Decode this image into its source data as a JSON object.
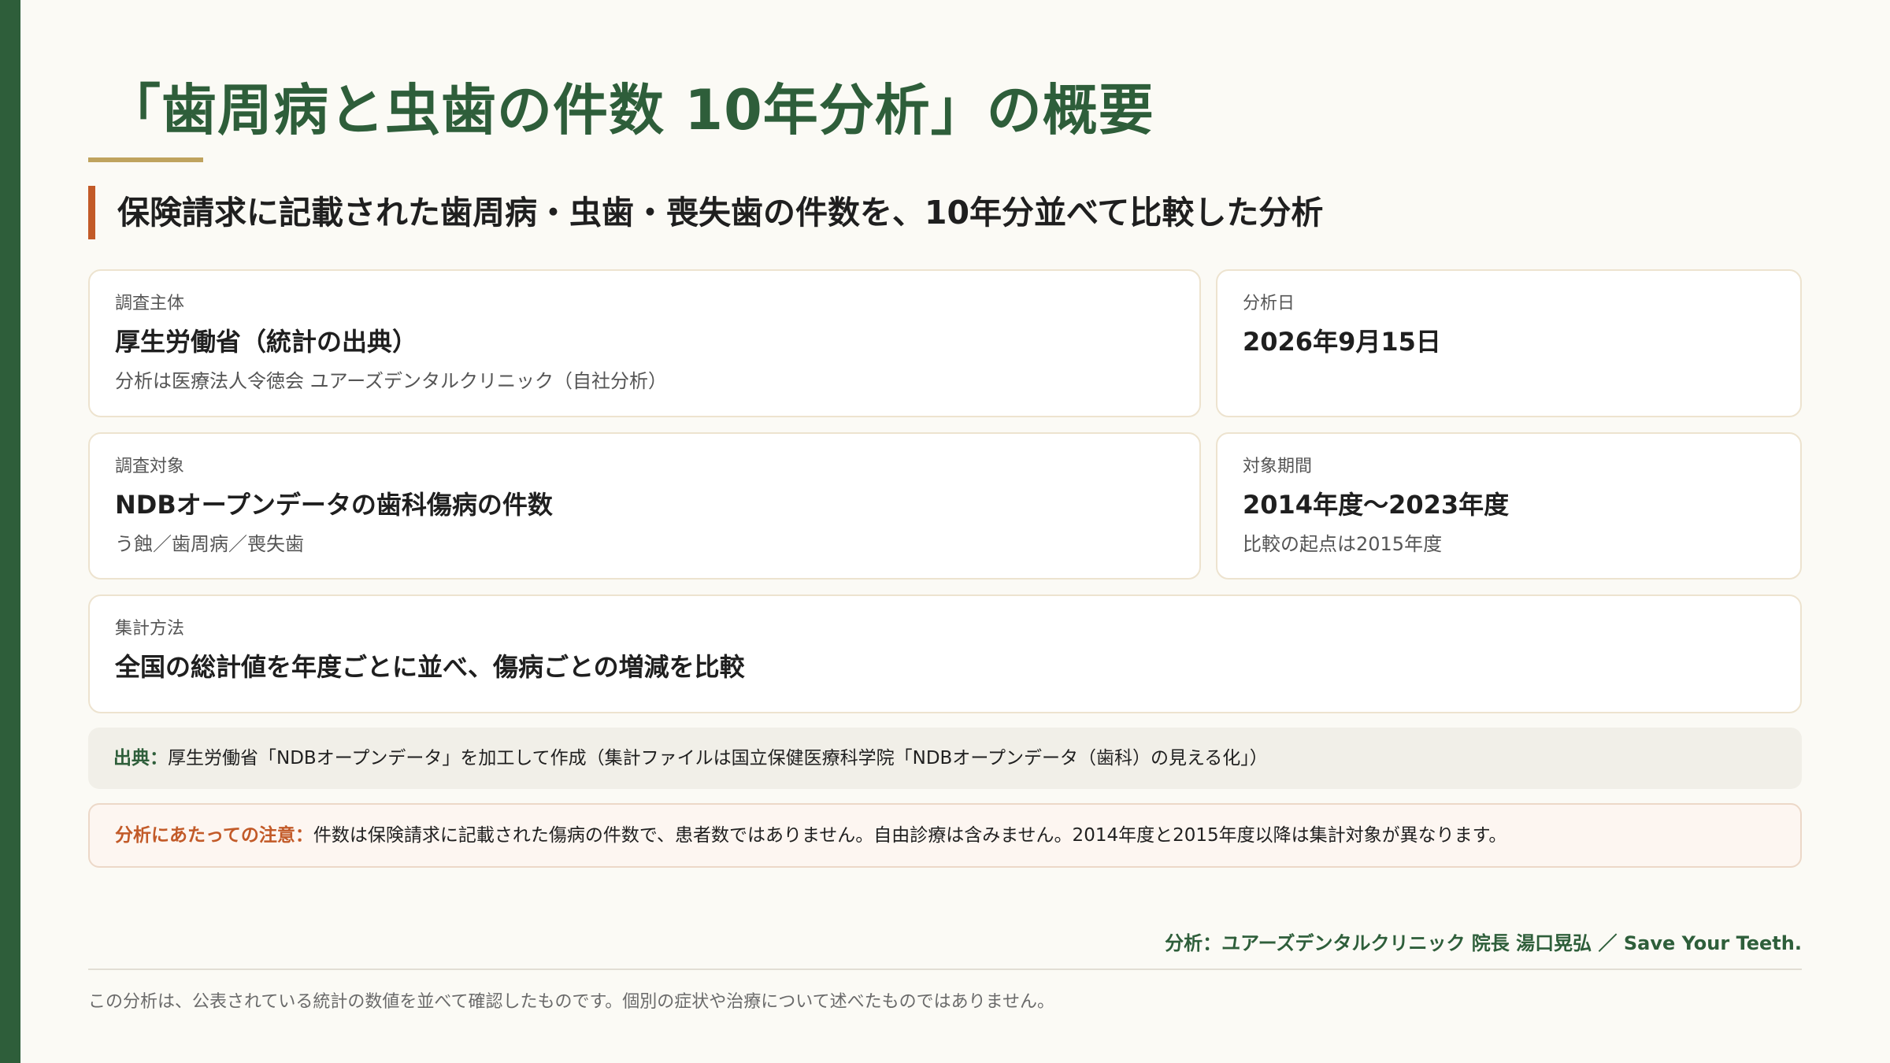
{
  "title": "「歯周病と虫歯の件数 10年分析」の概要",
  "subtitle": "保険請求に記載された歯周病・虫歯・喪失歯の件数を、10年分並べて比較した分析",
  "cards": {
    "investigator": {
      "label": "調査主体",
      "value": "厚生労働省（統計の出典）",
      "note": "分析は医療法人令徳会 ユアーズデンタルクリニック（自社分析）"
    },
    "analysis_date": {
      "label": "分析日",
      "value": "2026年9月15日"
    },
    "subject": {
      "label": "調査対象",
      "value": "NDBオープンデータの歯科傷病の件数",
      "note": "う蝕／歯周病／喪失歯"
    },
    "period": {
      "label": "対象期間",
      "value": "2014年度〜2023年度",
      "note": "比較の起点は2015年度"
    },
    "method": {
      "label": "集計方法",
      "value": "全国の総計値を年度ごとに並べ、傷病ごとの増減を比較"
    }
  },
  "source": {
    "label": "出典：",
    "text": "厚生労働省「NDBオープンデータ」を加工して作成（集計ファイルは国立保健医療科学院「NDBオープンデータ（歯科）の見える化」）"
  },
  "caution": {
    "label": "分析にあたっての注意：",
    "text": "件数は保険請求に記載された傷病の件数で、患者数ではありません。自由診療は含みません。2014年度と2015年度以降は集計対象が異なります。"
  },
  "author": "分析：ユアーズデンタルクリニック 院長 湯口晃弘 ／ Save Your Teeth.",
  "footnote": "この分析は、公表されている統計の数値を並べて確認したものです。個別の症状や治療について述べたものではありません。",
  "colors": {
    "brand_green": "#2e5e3a",
    "accent_orange": "#c25a28",
    "accent_gold": "#bfa35e",
    "background": "#fbfaf5"
  }
}
